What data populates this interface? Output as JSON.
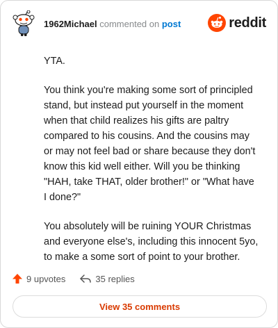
{
  "comment": {
    "author": "1962Michael",
    "action_text": "commented on",
    "target_link": "post",
    "paragraphs": [
      "YTA.",
      "You think you're making some sort of principled stand, but instead put yourself in the moment when that child realizes his gifts are paltry compared to his cousins. And the cousins may or may not feel bad or share because they don't know this kid well either. Will you be thinking \"HAH, take THAT, older brother!\" or \"What have I done?\"",
      "You absolutely will be ruining YOUR Christmas and everyone else's, including this innocent 5yo, to make a some sort of point to your brother."
    ]
  },
  "brand": {
    "name": "reddit",
    "color": "#ff4500",
    "icon": "reddit-logo-icon"
  },
  "stats": {
    "upvotes": "9 upvotes",
    "replies": "35 replies",
    "upvote_icon": "upvote-arrow-icon",
    "reply_icon": "reply-arrow-icon",
    "upvote_color": "#ff4500"
  },
  "actions": {
    "view_comments": "View 35 comments"
  }
}
